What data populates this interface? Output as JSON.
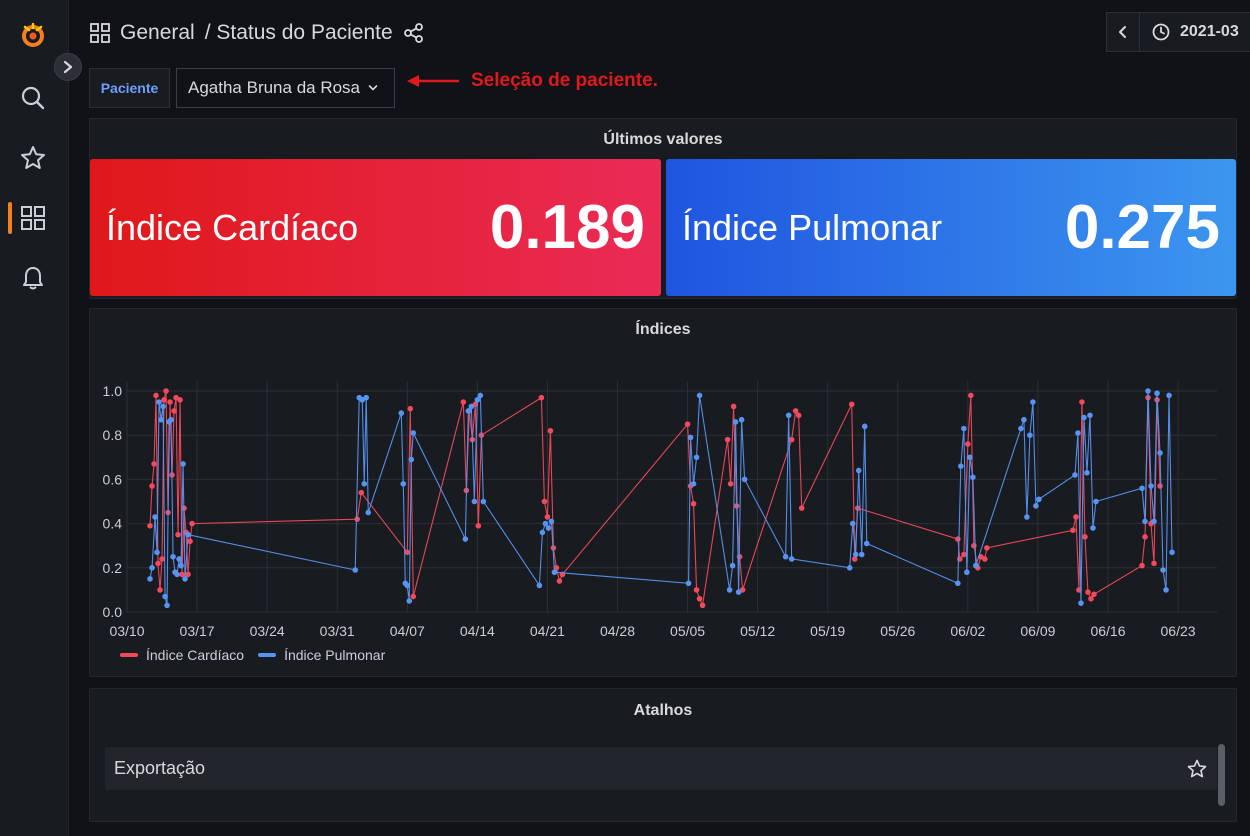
{
  "header": {
    "breadcrumb_folder": "General",
    "breadcrumb_dashboard": "/ Status do Paciente",
    "time_range": "2021-03"
  },
  "variables": {
    "label": "Paciente",
    "selected": "Agatha Bruna da Rosa"
  },
  "annotation": {
    "text": "Seleção de paciente.",
    "color": "#e0191b"
  },
  "stats_panel": {
    "title": "Últimos valores",
    "cards": [
      {
        "label": "Índice Cardíaco",
        "value": "0.189",
        "color": "#e0181a"
      },
      {
        "label": "Índice Pulmonar",
        "value": "0.275",
        "color": "#1f55e0"
      }
    ]
  },
  "chart_panel": {
    "title": "Índices"
  },
  "chart_data": {
    "type": "line",
    "title": "Índices",
    "xlabel": "",
    "ylabel": "",
    "x_ticks": [
      "03/10",
      "03/17",
      "03/24",
      "03/31",
      "04/07",
      "04/14",
      "04/21",
      "04/28",
      "05/05",
      "05/12",
      "05/19",
      "05/26",
      "06/02",
      "06/09",
      "06/16",
      "06/23"
    ],
    "y_ticks": [
      "0.0",
      "0.2",
      "0.4",
      "0.6",
      "0.8",
      "1.0"
    ],
    "ylim": [
      0,
      1.05
    ],
    "x_unit": "days since 03/10",
    "xlim": [
      0,
      106
    ],
    "grid": true,
    "legend_position": "bottom-left",
    "series": [
      {
        "name": "Índice Cardíaco",
        "color": "#f2495c",
        "points": [
          [
            2.3,
            0.39
          ],
          [
            2.5,
            0.57
          ],
          [
            2.7,
            0.67
          ],
          [
            2.9,
            0.98
          ],
          [
            3.1,
            0.22
          ],
          [
            3.3,
            0.1
          ],
          [
            3.5,
            0.24
          ],
          [
            3.7,
            0.96
          ],
          [
            3.9,
            1.0
          ],
          [
            4.1,
            0.45
          ],
          [
            4.3,
            0.95
          ],
          [
            4.5,
            0.62
          ],
          [
            4.7,
            0.91
          ],
          [
            4.9,
            0.97
          ],
          [
            5.1,
            0.35
          ],
          [
            5.3,
            0.96
          ],
          [
            5.5,
            0.17
          ],
          [
            5.7,
            0.47
          ],
          [
            5.9,
            0.36
          ],
          [
            6.1,
            0.17
          ],
          [
            6.3,
            0.32
          ],
          [
            6.5,
            0.4
          ],
          [
            23,
            0.42
          ],
          [
            23.4,
            0.54
          ],
          [
            28,
            0.27
          ],
          [
            28.3,
            0.92
          ],
          [
            28.6,
            0.07
          ],
          [
            33.6,
            0.95
          ],
          [
            33.9,
            0.55
          ],
          [
            34.2,
            0.91
          ],
          [
            34.5,
            0.78
          ],
          [
            34.8,
            0.94
          ],
          [
            35.1,
            0.39
          ],
          [
            35.4,
            0.8
          ],
          [
            41.4,
            0.97
          ],
          [
            41.7,
            0.5
          ],
          [
            42.0,
            0.43
          ],
          [
            42.3,
            0.82
          ],
          [
            42.6,
            0.29
          ],
          [
            42.9,
            0.2
          ],
          [
            43.2,
            0.14
          ],
          [
            43.5,
            0.17
          ],
          [
            56,
            0.85
          ],
          [
            56.3,
            0.57
          ],
          [
            56.6,
            0.49
          ],
          [
            56.9,
            0.1
          ],
          [
            57.2,
            0.06
          ],
          [
            57.5,
            0.03
          ],
          [
            60,
            0.78
          ],
          [
            60.3,
            0.58
          ],
          [
            60.6,
            0.93
          ],
          [
            60.9,
            0.48
          ],
          [
            61.2,
            0.25
          ],
          [
            61.5,
            0.1
          ],
          [
            66.4,
            0.78
          ],
          [
            66.8,
            0.91
          ],
          [
            67.1,
            0.89
          ],
          [
            67.4,
            0.47
          ],
          [
            72.4,
            0.94
          ],
          [
            72.7,
            0.24
          ],
          [
            73,
            0.47
          ],
          [
            83,
            0.33
          ],
          [
            83.2,
            0.24
          ],
          [
            83.6,
            0.26
          ],
          [
            84,
            0.76
          ],
          [
            84.3,
            0.98
          ],
          [
            84.6,
            0.3
          ],
          [
            85,
            0.2
          ],
          [
            85.3,
            0.25
          ],
          [
            85.7,
            0.24
          ],
          [
            85.9,
            0.29
          ],
          [
            94.5,
            0.37
          ],
          [
            94.8,
            0.43
          ],
          [
            95.1,
            0.1
          ],
          [
            95.4,
            0.95
          ],
          [
            95.7,
            0.34
          ],
          [
            96,
            0.09
          ],
          [
            96.3,
            0.06
          ],
          [
            96.6,
            0.08
          ],
          [
            101.4,
            0.21
          ],
          [
            101.7,
            0.34
          ],
          [
            102,
            0.97
          ],
          [
            102.3,
            0.4
          ],
          [
            102.6,
            0.22
          ],
          [
            102.9,
            0.96
          ],
          [
            103.2,
            0.57
          ]
        ]
      },
      {
        "name": "Índice Pulmonar",
        "color": "#5794f2",
        "points": [
          [
            2.3,
            0.15
          ],
          [
            2.5,
            0.2
          ],
          [
            2.8,
            0.43
          ],
          [
            3.0,
            0.27
          ],
          [
            3.2,
            0.95
          ],
          [
            3.4,
            0.87
          ],
          [
            3.6,
            0.93
          ],
          [
            3.8,
            0.07
          ],
          [
            4.0,
            0.03
          ],
          [
            4.2,
            0.86
          ],
          [
            4.4,
            0.87
          ],
          [
            4.6,
            0.25
          ],
          [
            4.8,
            0.18
          ],
          [
            5.0,
            0.17
          ],
          [
            5.2,
            0.24
          ],
          [
            5.4,
            0.21
          ],
          [
            5.6,
            0.67
          ],
          [
            5.8,
            0.15
          ],
          [
            6.1,
            0.35
          ],
          [
            22.8,
            0.19
          ],
          [
            23.2,
            0.97
          ],
          [
            23.5,
            0.96
          ],
          [
            23.7,
            0.58
          ],
          [
            23.9,
            0.97
          ],
          [
            24.1,
            0.45
          ],
          [
            27.4,
            0.9
          ],
          [
            27.6,
            0.58
          ],
          [
            27.8,
            0.13
          ],
          [
            28.0,
            0.12
          ],
          [
            28.2,
            0.05
          ],
          [
            28.4,
            0.69
          ],
          [
            28.6,
            0.81
          ],
          [
            33.8,
            0.33
          ],
          [
            34.1,
            0.91
          ],
          [
            34.4,
            0.93
          ],
          [
            34.7,
            0.5
          ],
          [
            35.0,
            0.96
          ],
          [
            35.3,
            0.98
          ],
          [
            35.6,
            0.5
          ],
          [
            41.2,
            0.12
          ],
          [
            41.5,
            0.36
          ],
          [
            41.8,
            0.4
          ],
          [
            42.1,
            0.38
          ],
          [
            42.4,
            0.41
          ],
          [
            42.7,
            0.18
          ],
          [
            56.1,
            0.13
          ],
          [
            56.3,
            0.79
          ],
          [
            56.6,
            0.58
          ],
          [
            56.9,
            0.7
          ],
          [
            57.2,
            0.98
          ],
          [
            60.2,
            0.1
          ],
          [
            60.5,
            0.21
          ],
          [
            60.8,
            0.86
          ],
          [
            61.1,
            0.09
          ],
          [
            61.4,
            0.87
          ],
          [
            61.7,
            0.6
          ],
          [
            65.8,
            0.25
          ],
          [
            66.1,
            0.89
          ],
          [
            66.4,
            0.24
          ],
          [
            72.2,
            0.2
          ],
          [
            72.5,
            0.4
          ],
          [
            72.8,
            0.26
          ],
          [
            73.1,
            0.64
          ],
          [
            73.4,
            0.26
          ],
          [
            73.7,
            0.84
          ],
          [
            73.9,
            0.31
          ],
          [
            83.0,
            0.13
          ],
          [
            83.3,
            0.66
          ],
          [
            83.6,
            0.83
          ],
          [
            83.9,
            0.18
          ],
          [
            84.2,
            0.7
          ],
          [
            84.5,
            0.61
          ],
          [
            84.8,
            0.21
          ],
          [
            89.3,
            0.83
          ],
          [
            89.6,
            0.87
          ],
          [
            89.9,
            0.43
          ],
          [
            90.2,
            0.8
          ],
          [
            90.5,
            0.95
          ],
          [
            90.8,
            0.48
          ],
          [
            91.1,
            0.51
          ],
          [
            94.7,
            0.62
          ],
          [
            95.0,
            0.81
          ],
          [
            95.3,
            0.04
          ],
          [
            95.6,
            0.88
          ],
          [
            95.9,
            0.63
          ],
          [
            96.2,
            0.89
          ],
          [
            96.5,
            0.38
          ],
          [
            96.8,
            0.5
          ],
          [
            101.4,
            0.56
          ],
          [
            101.7,
            0.41
          ],
          [
            102.0,
            1.0
          ],
          [
            102.3,
            0.57
          ],
          [
            102.6,
            0.41
          ],
          [
            102.9,
            0.99
          ],
          [
            103.2,
            0.72
          ],
          [
            103.5,
            0.19
          ],
          [
            103.8,
            0.1
          ],
          [
            104.1,
            0.98
          ],
          [
            104.4,
            0.27
          ]
        ]
      }
    ]
  },
  "shortcuts_panel": {
    "title": "Atalhos",
    "items": [
      {
        "label": "Exportação"
      }
    ]
  }
}
